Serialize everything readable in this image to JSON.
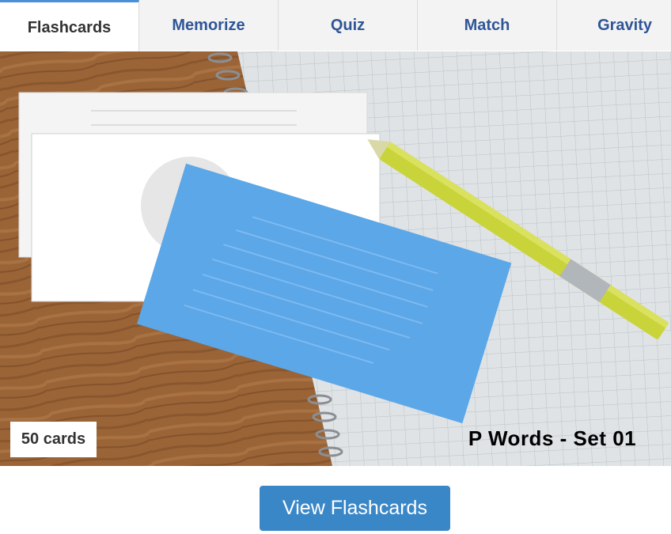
{
  "tabs": [
    {
      "label": "Flashcards",
      "active": true
    },
    {
      "label": "Memorize",
      "active": false
    },
    {
      "label": "Quiz",
      "active": false
    },
    {
      "label": "Match",
      "active": false
    },
    {
      "label": "Gravity",
      "active": false
    }
  ],
  "deck": {
    "card_count": "50 cards",
    "title": "P Words - Set 01"
  },
  "actions": {
    "view_label": "View Flashcards"
  },
  "colors": {
    "tab_text": "#2f5597",
    "active_tab_accent": "#4a90d9",
    "button_bg": "#3a87c8",
    "card_blue": "#5ba7e8",
    "pencil_yellow": "#c9d43a"
  }
}
